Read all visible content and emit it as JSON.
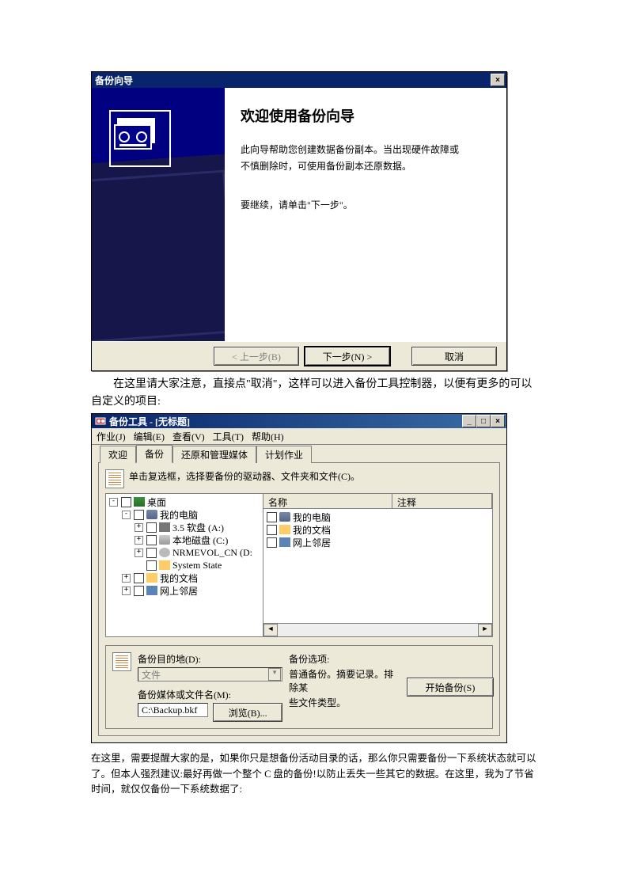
{
  "wizard": {
    "title": "备份向导",
    "heading": "欢迎使用备份向导",
    "desc1": "此向导帮助您创建数据备份副本。当出现硬件故障或",
    "desc2": "不慎删除时，可使用备份副本还原数据。",
    "cont": "要继续，请单击\"下一步\"。",
    "back": "< 上一步(B)",
    "next": "下一步(N) >",
    "cancel": "取消"
  },
  "para1": "在这里请大家注意，直接点\"取消\"，这样可以进入备份工具控制器，以便有更多的可以自定义的项目:",
  "tool": {
    "title": "备份工具 - [无标题]",
    "menu": {
      "job": "作业(J)",
      "edit": "编辑(E)",
      "view": "查看(V)",
      "tools": "工具(T)",
      "help": "帮助(H)"
    },
    "tabs": {
      "welcome": "欢迎",
      "backup": "备份",
      "restore": "还原和管理媒体",
      "schedule": "计划作业"
    },
    "instr": "单击复选框，选择要备份的驱动器、文件夹和文件(C)。",
    "tree": {
      "desktop": "桌面",
      "pc": "我的电脑",
      "floppy": "3.5 软盘 (A:)",
      "localC": "本地磁盘 (C:)",
      "cd": "NRMEVOL_CN (D:",
      "sys": "System State",
      "docs": "我的文档",
      "net": "网上邻居"
    },
    "list": {
      "h_name": "名称",
      "h_comment": "注释",
      "pc": "我的电脑",
      "docs": "我的文档",
      "net": "网上邻居"
    },
    "dest": {
      "dest_label": "备份目的地(D):",
      "dest_value": "文件",
      "media_label": "备份媒体或文件名(M):",
      "media_value": "C:\\Backup.bkf",
      "browse": "浏览(B)...",
      "opts_label": "备份选项:",
      "opts_line1": "普通备份。摘要记录。排除某",
      "opts_line2": "些文件类型。",
      "start": "开始备份(S)"
    }
  },
  "para2": "在这里，需要提醒大家的是，如果你只是想备份活动目录的话，那么你只需要备份一下系统状态就可以了。但本人强烈建议:最好再做一个整个 C 盘的备份!以防止丢失一些其它的数据。在这里，我为了节省时间，就仅仅备份一下系统数据了:"
}
